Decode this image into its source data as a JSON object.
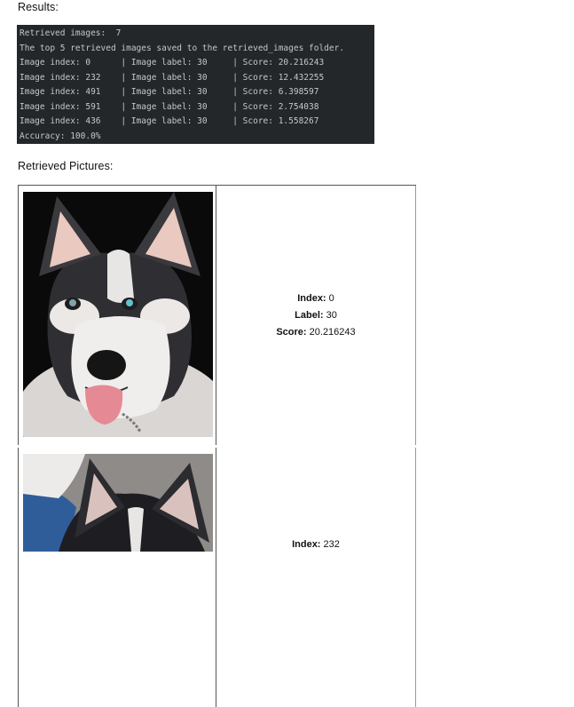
{
  "results_heading": "Results:",
  "console": {
    "lines": [
      "Retrieved images:  7",
      "The top 5 retrieved images saved to the retrieved_images folder.",
      "Image index: 0      | Image label: 30     | Score: 20.216243",
      "Image index: 232    | Image label: 30     | Score: 12.432255",
      "Image index: 491    | Image label: 30     | Score: 6.398597",
      "Image index: 591    | Image label: 30     | Score: 2.754038",
      "Image index: 436    | Image label: 30     | Score: 1.558267",
      "Accuracy: 100.0%"
    ]
  },
  "pictures_heading": "Retrieved Pictures:",
  "results": [
    {
      "index_label": "Index:",
      "index_value": " 0",
      "label_label": "Label:",
      "label_value": " 30",
      "score_label": "Score:",
      "score_value": " 20.216243",
      "image": "husky-dog-photo"
    },
    {
      "index_label": "Index:",
      "index_value": " 232",
      "image": "husky-puppy-photo"
    }
  ],
  "colors": {
    "console_bg": "#24272a",
    "console_text": "#c4c8c8"
  }
}
